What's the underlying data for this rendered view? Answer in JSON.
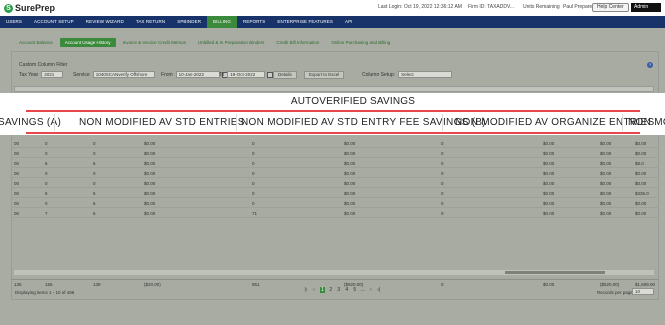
{
  "app": {
    "brand": "SurePrep",
    "brand_mark": "S"
  },
  "topbar": {
    "last_login": "Last Login: Oct 19, 2022 12:36:12 AM",
    "firm_id": "Firm ID: TAXADDV...",
    "units": "Units Remaining",
    "user": "Paul Preparer",
    "help_label": "Help Center",
    "admin_label": "Admin"
  },
  "nav": [
    "USERS",
    "ACCOUNT SETUP",
    "REVIEW WIZARD",
    "TAX RETURN",
    "SPBINDER",
    "BILLING",
    "REPORTS",
    "ENTERPRISE FEATURES",
    "API"
  ],
  "nav_active_index": 5,
  "subtabs": [
    "Account Balance",
    "Account Usage History",
    "Invoice & Invoice Credit Memos",
    "Unbilled & In Preparation Binders",
    "Credit Bill Information",
    "Online Purchasing and Billing"
  ],
  "subtab_active_index": 1,
  "filters": {
    "title": "Custom Column Filter",
    "tax_year_label": "Tax Year",
    "tax_year": "2021",
    "service_label": "Service",
    "service": "1040SCANverify Offshore",
    "from_label": "From",
    "from_date": "10-Jan-2022",
    "to_label": "To",
    "to_date": "19-Oct-2022",
    "details_label": "Details",
    "export_label": "Export to Excel",
    "column_setup_label": "Column Setup:",
    "column_setup": "Select"
  },
  "banner": {
    "title": "AUTOVERIFIED SAVINGS",
    "headers": [
      "SAVINGS (A)",
      "NON MODIFIED AV STD ENTRIES",
      "NON MODIFIED AV STD ENTRY FEE SAVINGS (B)",
      "NON MODIFIED AV ORGANIZE ENTRIES",
      "NON MO"
    ]
  },
  "table": {
    "rows": [
      [
        "00",
        "0",
        "0",
        "$0.00",
        "0",
        "$0.00",
        "0",
        "$0.00",
        "$0.00",
        "$0.00"
      ],
      [
        "00",
        "0",
        "0",
        "$0.00",
        "0",
        "$0.00",
        "0",
        "$0.00",
        "$0.00",
        "$0.00"
      ],
      [
        "00",
        "6",
        "6",
        "$0.00",
        "0",
        "$0.00",
        "0",
        "$0.00",
        "$0.00",
        "$8.0"
      ],
      [
        "00",
        "0",
        "0",
        "$0.00",
        "0",
        "$0.00",
        "0",
        "$0.00",
        "$0.00",
        "$0.00"
      ],
      [
        "00",
        "0",
        "0",
        "$0.00",
        "0",
        "$0.00",
        "0",
        "$0.00",
        "$0.00",
        "$0.00"
      ],
      [
        "00",
        "6",
        "5",
        "$0.00",
        "0",
        "$0.00",
        "0",
        "$0.00",
        "$0.00",
        "$335.0"
      ],
      [
        "00",
        "0",
        "6",
        "$0.00",
        "0",
        "$0.00",
        "0",
        "$0.00",
        "$0.00",
        "$0.00"
      ],
      [
        "00",
        "7",
        "6",
        "$0.00",
        "71",
        "$0.00",
        "0",
        "$0.00",
        "$0.00",
        "$0.00"
      ]
    ],
    "totals": [
      "135",
      "155",
      "139",
      "($20.00)",
      "851",
      "($920.00)",
      "0",
      "$0.00",
      "($520.00)",
      "$1,609.00"
    ]
  },
  "footer": {
    "displaying": "Displaying items 1 - 10 of 496",
    "pages": [
      "1",
      "2",
      "3",
      "4",
      "5",
      "...",
      "50"
    ],
    "current_page": "1",
    "records_label": "Records per page:",
    "records_value": "10"
  },
  "colors": {
    "nav_bg": "#17336a",
    "accent_green": "#3b8a3b",
    "banner_red": "#e8464c"
  }
}
